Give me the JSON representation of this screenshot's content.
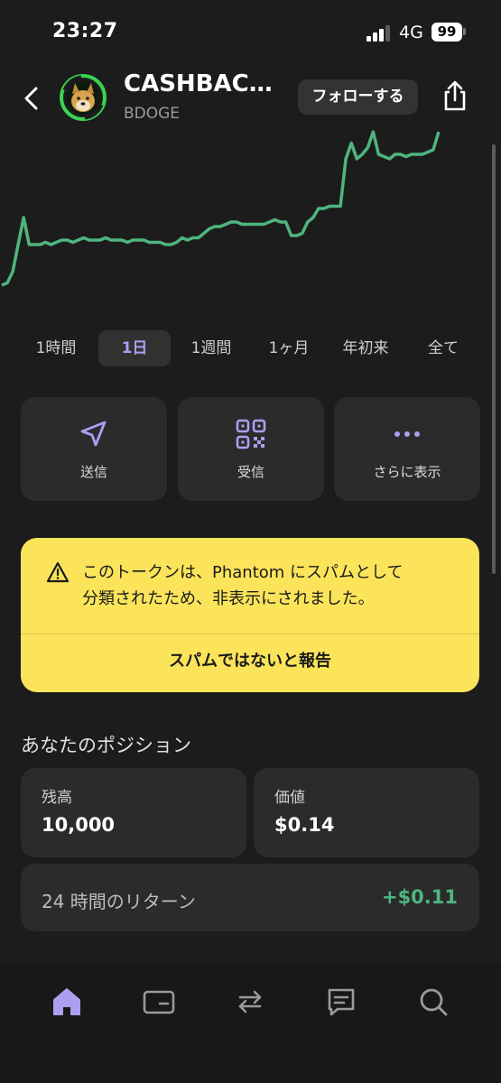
{
  "status_bar": {
    "time": "23:27",
    "network": "4G",
    "battery": "99"
  },
  "header": {
    "back_icon": "chevron-left-icon",
    "token_name": "CASHBAC…",
    "token_symbol": "BDOGE",
    "follow_label": "フォローする",
    "share_icon": "share-icon"
  },
  "chart_data": {
    "type": "line",
    "title": "",
    "xlabel": "",
    "ylabel": "",
    "color": "#4eb57e",
    "values": [
      0.32,
      0.33,
      0.38,
      0.5,
      0.62,
      0.5,
      0.5,
      0.5,
      0.51,
      0.5,
      0.51,
      0.52,
      0.52,
      0.51,
      0.52,
      0.53,
      0.52,
      0.52,
      0.52,
      0.53,
      0.52,
      0.52,
      0.52,
      0.51,
      0.52,
      0.52,
      0.52,
      0.51,
      0.51,
      0.51,
      0.5,
      0.5,
      0.51,
      0.53,
      0.52,
      0.53,
      0.53,
      0.55,
      0.57,
      0.58,
      0.58,
      0.59,
      0.6,
      0.6,
      0.59,
      0.59,
      0.59,
      0.59,
      0.59,
      0.6,
      0.61,
      0.6,
      0.6,
      0.54,
      0.54,
      0.55,
      0.6,
      0.62,
      0.66,
      0.66,
      0.67,
      0.67,
      0.67,
      0.88,
      0.95,
      0.88,
      0.9,
      0.93,
      1.0,
      0.9,
      0.89,
      0.88,
      0.9,
      0.9,
      0.89,
      0.9,
      0.9,
      0.9,
      0.91,
      0.92,
      1.0
    ]
  },
  "range_tabs": [
    {
      "label": "1時間",
      "active": false
    },
    {
      "label": "1日",
      "active": true
    },
    {
      "label": "1週間",
      "active": false
    },
    {
      "label": "1ヶ月",
      "active": false
    },
    {
      "label": "年初来",
      "active": false
    },
    {
      "label": "全て",
      "active": false
    }
  ],
  "actions": [
    {
      "label": "送信",
      "icon": "send-icon"
    },
    {
      "label": "受信",
      "icon": "qr-code-icon"
    },
    {
      "label": "さらに表示",
      "icon": "more-dots-icon"
    }
  ],
  "spam_banner": {
    "icon": "warning-icon",
    "message_line1": "このトークンは、Phantom にスパムとして",
    "message_line2": "分類されたため、非表示にされました。",
    "report_label": "スパムではないと報告"
  },
  "position": {
    "title": "あなたのポジション",
    "balance_label": "残高",
    "balance_value": "10,000",
    "value_label": "価値",
    "value_value": "$0.14",
    "return_label": "24 時間のリターン",
    "return_value": "+$0.11"
  },
  "bottom_nav": [
    {
      "icon": "home-icon",
      "active": true
    },
    {
      "icon": "wallet-icon",
      "active": false
    },
    {
      "icon": "swap-icon",
      "active": false
    },
    {
      "icon": "chat-icon",
      "active": false
    },
    {
      "icon": "search-icon",
      "active": false
    }
  ],
  "colors": {
    "background": "#1c1c1c",
    "accent": "#ab9ff2",
    "positive": "#4eb57e",
    "banner": "#fbe45a"
  }
}
